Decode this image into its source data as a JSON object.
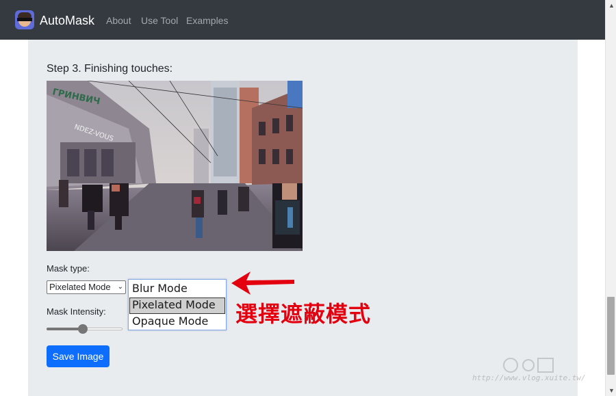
{
  "navbar": {
    "brand": "AutoMask",
    "links": [
      "About",
      "Use Tool",
      "Examples"
    ]
  },
  "step": {
    "title": "Step 3. Finishing touches:"
  },
  "photo": {
    "alt": "street scene with pixelated people",
    "shop_sign": "ГРИНВИЧ",
    "store_sign": "NDEZ-VOUS"
  },
  "mask_type": {
    "label": "Mask type:",
    "selected": "Pixelated Mode",
    "options": [
      "Blur Mode",
      "Pixelated Mode",
      "Opaque Mode"
    ]
  },
  "intensity": {
    "label": "Mask Intensity:",
    "value_fraction": 0.48
  },
  "save_button": "Save Image",
  "annotation": {
    "text": "選擇遮蔽模式",
    "color": "#e3000f"
  },
  "watermark": {
    "url": "http://www.vlog.xuite.tw/"
  },
  "colors": {
    "navbar": "#343a40",
    "primary": "#0d6efd",
    "card": "#e9ecef"
  }
}
